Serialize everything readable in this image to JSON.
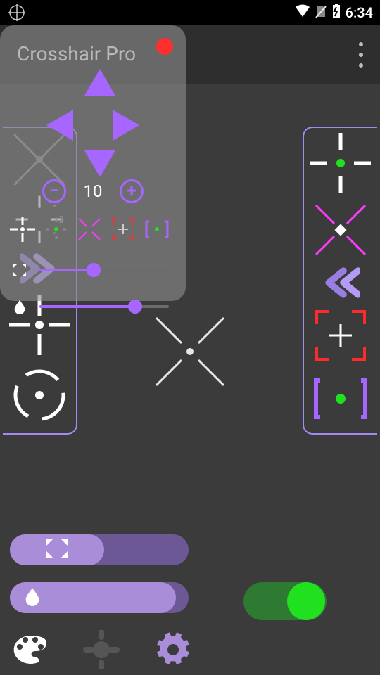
{
  "status": {
    "time": "6:34"
  },
  "app": {
    "title": "Crosshair Pro"
  },
  "overlay": {
    "step_value": "10",
    "recording": true,
    "styles": [
      "plus-dot",
      "dot-dashes",
      "pink-x",
      "red-brackets-plus",
      "green-dot-bracket"
    ]
  },
  "sliders": {
    "size": 0.42,
    "opacity": 0.74
  },
  "left_presets": [
    "diag-x-grey",
    "plus-dot-dashes",
    "chevrons-right",
    "cross-dot",
    "radar-circle"
  ],
  "right_presets": [
    "dashes-green-dot",
    "pink-x-diamond",
    "chevrons-left",
    "red-bracket-plus",
    "green-dot-bracket"
  ],
  "bottom": {
    "size_pct": 0.52,
    "opacity_pct": 0.92,
    "toggle_on": true
  },
  "colors": {
    "accent": "#a666ff",
    "pink": "#ff3aff",
    "red": "#ff2a2a",
    "green": "#20e020"
  }
}
